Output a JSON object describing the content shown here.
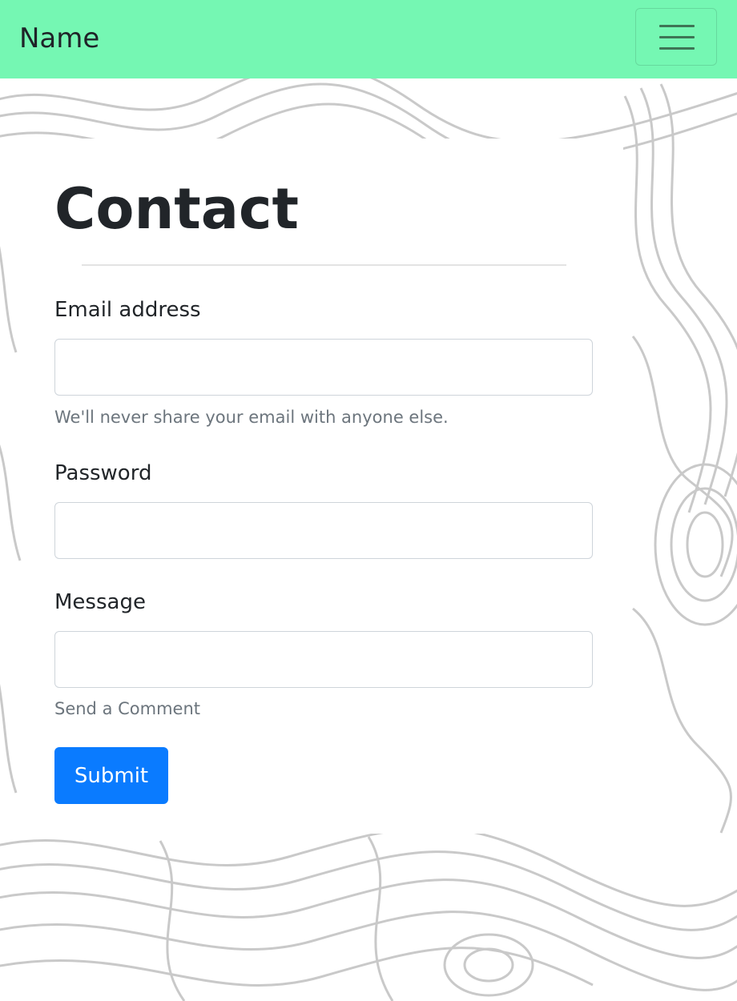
{
  "navbar": {
    "brand": "Name",
    "toggle_icon": "hamburger-menu-icon"
  },
  "contact": {
    "title": "Contact",
    "email": {
      "label": "Email address",
      "value": "",
      "help": "We'll never share your email with anyone else."
    },
    "password": {
      "label": "Password",
      "value": ""
    },
    "message": {
      "label": "Message",
      "value": "",
      "help": "Send a Comment"
    },
    "submit_label": "Submit"
  },
  "colors": {
    "navbar_bg": "#75f7b3",
    "primary": "#0a7bff",
    "muted_text": "#6c757d",
    "body_text": "#212529"
  }
}
